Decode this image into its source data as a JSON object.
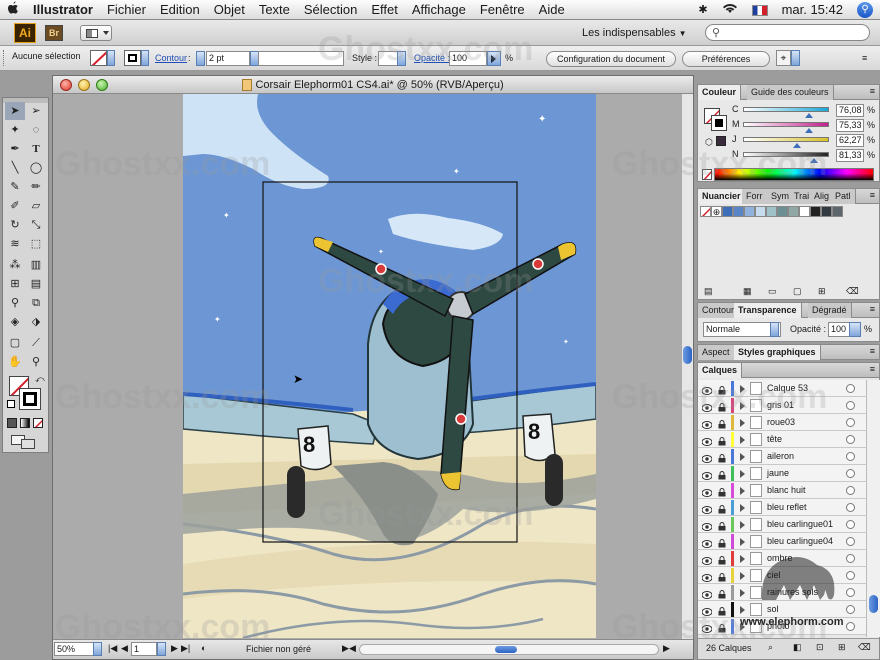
{
  "menubar": {
    "apple_icon": "apple-icon",
    "app_name": "Illustrator",
    "items": [
      "Fichier",
      "Edition",
      "Objet",
      "Texte",
      "Sélection",
      "Effet",
      "Affichage",
      "Fenêtre",
      "Aide"
    ],
    "clock": "mar. 15:42"
  },
  "appbar": {
    "workspace": "Les indispensables",
    "search_placeholder": ""
  },
  "control": {
    "selection": "Aucune sélection",
    "contour_label": "Contour",
    "contour_value": "2 pt",
    "style_label": "Style :",
    "opacity_label": "Opacité :",
    "opacity_value": "100",
    "opacity_unit": "%",
    "config_button": "Configuration du document",
    "prefs_button": "Préférences"
  },
  "document": {
    "title": "Corsair Elephorm01 CS4.ai* @ 50% (RVB/Aperçu)",
    "zoom": "50%",
    "page": "1",
    "status": "Fichier non géré",
    "nose_number_left": "8",
    "nose_number_right": "8"
  },
  "color_panel": {
    "tabs": [
      "Couleur",
      "Guide des couleurs"
    ],
    "channels": [
      {
        "label": "C",
        "value": "76,08",
        "unit": "%",
        "color": "#1aa8d6",
        "position": 0.76
      },
      {
        "label": "M",
        "value": "75,33",
        "unit": "%",
        "color": "#c2208e",
        "position": 0.75
      },
      {
        "label": "J",
        "value": "62,27",
        "unit": "%",
        "color": "#d8c22a",
        "position": 0.62
      },
      {
        "label": "N",
        "value": "81,33",
        "unit": "%",
        "color": "#222222",
        "position": 0.81
      }
    ]
  },
  "swatch_panel": {
    "tabs": [
      "Nuancier",
      "Forr",
      "Sym",
      "Trai",
      "Alig",
      "Patl"
    ],
    "swatches": [
      "#3d6fb8",
      "#5a86c8",
      "#8fb3dd",
      "#c8dcef",
      "#9fc2c9",
      "#6b8f93",
      "#8fa8a6",
      "#ffffff",
      "#222222",
      "#333a40",
      "#5d666b"
    ]
  },
  "transparency_panel": {
    "tabs": [
      "Contour",
      "Transparence",
      "Dégradé"
    ],
    "mode": "Normale",
    "opacity_label": "Opacité :",
    "opacity_value": "100",
    "opacity_unit": "%"
  },
  "aspect_panel": {
    "tabs": [
      "Aspect",
      "Styles graphiques"
    ]
  },
  "layers_panel": {
    "title": "Calques",
    "layers": [
      {
        "name": "Calque 53",
        "color": "#4a78d8"
      },
      {
        "name": "gris 01",
        "color": "#d6467c"
      },
      {
        "name": "roue03",
        "color": "#e0b83a"
      },
      {
        "name": "tête",
        "color": "#ffff33"
      },
      {
        "name": "aileron",
        "color": "#4a78d8"
      },
      {
        "name": "jaune",
        "color": "#3fbf5a"
      },
      {
        "name": "blanc huit",
        "color": "#d84ad8"
      },
      {
        "name": "bleu reflet",
        "color": "#4a9ed8"
      },
      {
        "name": "bleu carlingue01",
        "color": "#6ac75a"
      },
      {
        "name": "bleu carlingue04",
        "color": "#cf4ad8"
      },
      {
        "name": "ombre",
        "color": "#e03a3a"
      },
      {
        "name": "ciel",
        "color": "#e8d23a"
      },
      {
        "name": "rainures sols",
        "color": "#9a9a9a"
      },
      {
        "name": "sol",
        "color": "#111111"
      },
      {
        "name": "photo",
        "color": "#5a7fd8"
      }
    ],
    "count": "26 Calques"
  },
  "watermark": {
    "text": "Ghostxx.com",
    "site": "www.elephorm.com"
  },
  "colors": {
    "sky": "#6d97d4",
    "ground": "#efe6c6",
    "plane_dark": "#2e4842",
    "accent_yellow": "#ecc432"
  }
}
